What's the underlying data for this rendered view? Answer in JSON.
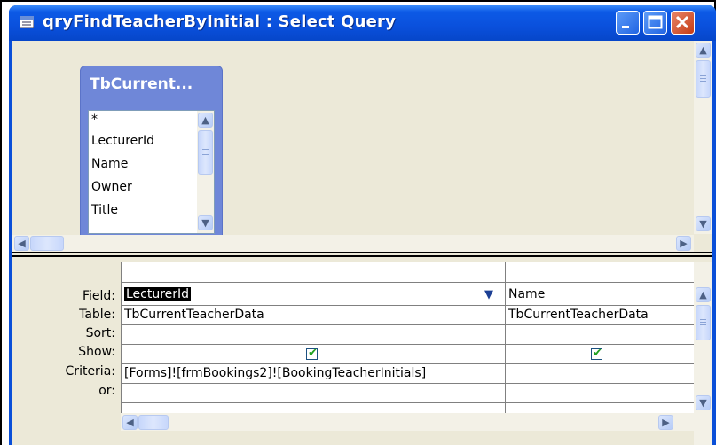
{
  "window": {
    "title": "qryFindTeacherByInitial : Select Query",
    "icon": "query-icon"
  },
  "table": {
    "title": "TbCurrent...",
    "fields": [
      "*",
      "LecturerId",
      "Name",
      "Owner",
      "Title"
    ]
  },
  "grid": {
    "row_labels": [
      "Field:",
      "Table:",
      "Sort:",
      "Show:",
      "Criteria:",
      "or:"
    ],
    "columns": [
      {
        "field": "LecturerId",
        "table": "TbCurrentTeacherData",
        "sort": "",
        "show": true,
        "criteria": "[Forms]![frmBookings2]![BookingTeacherInitials]",
        "or": ""
      },
      {
        "field": "Name",
        "table": "TbCurrentTeacherData",
        "sort": "",
        "show": true,
        "criteria": "",
        "or": ""
      }
    ]
  },
  "colors": {
    "titlebar": "#0a50dc",
    "client": "#ece9d8",
    "table_header": "#6f87d8",
    "check": "#21a121"
  }
}
